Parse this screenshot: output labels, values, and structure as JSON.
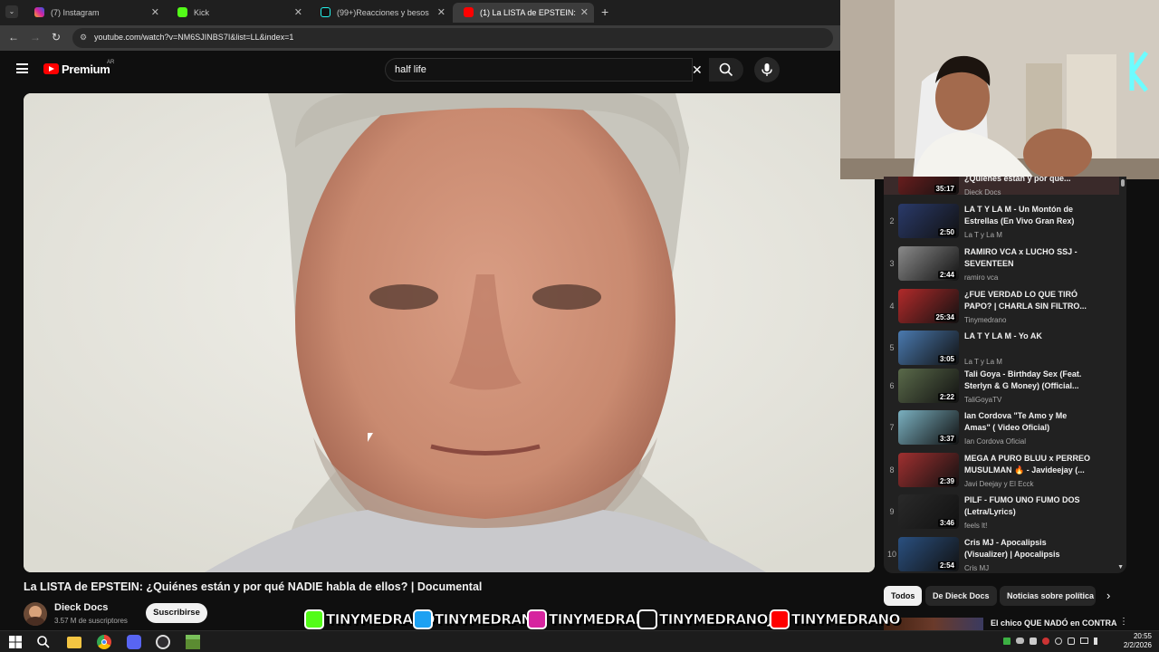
{
  "browser": {
    "tabs": [
      {
        "label": "(7) Instagram",
        "active": false
      },
      {
        "label": "Kick",
        "active": false
      },
      {
        "label": "(99+)Reacciones y besos de Ali",
        "active": false
      },
      {
        "label": "(1) La LISTA de EPSTEIN: ¿Quién",
        "active": true
      }
    ],
    "url": "youtube.com/watch?v=NM6SJINBS7I&list=LL&index=1"
  },
  "youtube": {
    "brand": "Premium",
    "region": "AR",
    "search_value": "half life"
  },
  "video": {
    "title": "La LISTA de EPSTEIN: ¿Quiénes están y por qué NADIE habla de ellos? | Documental",
    "channel": "Dieck Docs",
    "subscribers": "3.57 M de suscriptores",
    "subscribe_label": "Suscribirse"
  },
  "playlist": {
    "items": [
      {
        "num": "",
        "title": "¿Quiénes están y por qué...",
        "channel": "Dieck Docs",
        "duration": "35:17",
        "color": "#7a2020"
      },
      {
        "num": "2",
        "title": "LA T Y LA M - Un Montón de Estrellas (En Vivo Gran Rex)",
        "channel": "La T y La M",
        "duration": "2:50",
        "color": "#2a3a6a"
      },
      {
        "num": "3",
        "title": "RAMIRO VCA x LUCHO SSJ - SEVENTEEN",
        "channel": "ramiro vca",
        "duration": "2:44",
        "color": "#8a8a8a"
      },
      {
        "num": "4",
        "title": "¿FUE VERDAD LO QUE TIRÓ PAPO? | CHARLA SIN FILTRO...",
        "channel": "Tinymedrano",
        "duration": "25:34",
        "color": "#b22a2a"
      },
      {
        "num": "5",
        "title": "LA T Y LA M - Yo AK",
        "channel": "La T y La M",
        "duration": "3:05",
        "color": "#4a7ab0"
      },
      {
        "num": "6",
        "title": "Tali Goya - Birthday Sex (Feat. Sterlyn & G Money) (Official...",
        "channel": "TaliGoyaTV",
        "duration": "2:22",
        "color": "#5a6a4a"
      },
      {
        "num": "7",
        "title": "Ian Cordova \"Te Amo y Me Amas\" ( Video Oficial)",
        "channel": "Ian Cordova Oficial",
        "duration": "3:37",
        "color": "#7ab0c0"
      },
      {
        "num": "8",
        "title": "MEGA A PURO BLUU x PERREO MUSULMAN 🔥 - Javideejay (...",
        "channel": "Javi Deejay y El Ecck",
        "duration": "2:39",
        "color": "#a03030"
      },
      {
        "num": "9",
        "title": "PILF - FUMO UNO FUMO DOS (Letra/Lyrics)",
        "channel": "feels lt!",
        "duration": "3:46",
        "color": "#2a2a2a"
      },
      {
        "num": "10",
        "title": "Cris MJ - Apocalipsis (Visualizer) | Apocalipsis",
        "channel": "Cris MJ",
        "duration": "2:54",
        "color": "#2a5080"
      }
    ]
  },
  "chips": [
    {
      "label": "Todos",
      "active": true
    },
    {
      "label": "De Dieck Docs",
      "active": false
    },
    {
      "label": "Noticias sobre política",
      "active": false
    }
  ],
  "next_video": {
    "title": "El chico QUE NADÓ en CONTRA"
  },
  "banner": {
    "handles": [
      {
        "label": "TINYMEDRANO",
        "icon": "kick-icon",
        "color": "#53fc18"
      },
      {
        "label": "TINYMEDRANO",
        "icon": "twitter-icon",
        "color": "#1da1f2"
      },
      {
        "label": "TINYMEDRANO",
        "icon": "instagram-icon",
        "color": "#d6249f"
      },
      {
        "label": "TINYMEDRANOJR",
        "icon": "tiktok-icon",
        "color": "#111111"
      },
      {
        "label": "TINYMEDRANO",
        "icon": "youtube-icon",
        "color": "#ff0000"
      }
    ]
  },
  "taskbar": {
    "time": "20:55",
    "date": "2/2/2026"
  },
  "colors": {
    "yt_red": "#ff0000",
    "kick_green": "#53fc18"
  }
}
